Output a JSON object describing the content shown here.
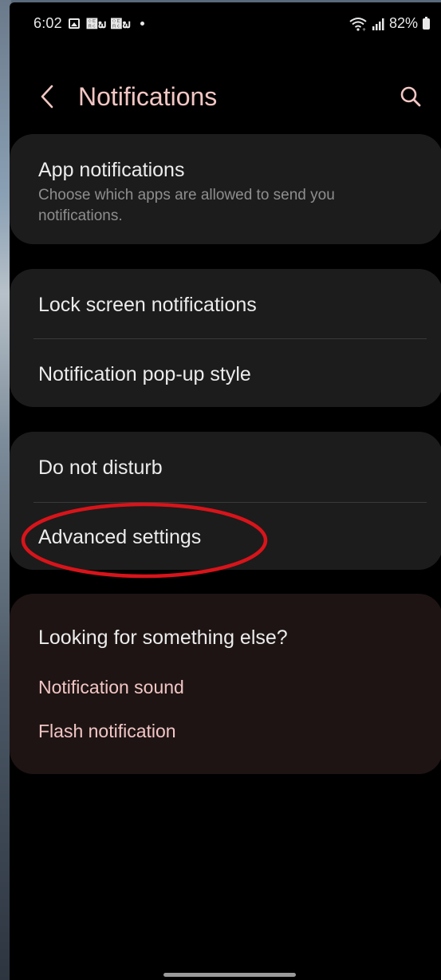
{
  "status_bar": {
    "time": "6:02",
    "app_glyphs": "຦ພ ຦ພ",
    "battery": "82%",
    "icons": [
      "gallery-icon",
      "wifi-icon",
      "signal-icon",
      "battery-icon"
    ]
  },
  "header": {
    "title": "Notifications",
    "icons": [
      "back-arrow-icon",
      "search-icon"
    ]
  },
  "sections": {
    "app_notifications": {
      "title": "App notifications",
      "subtitle": "Choose which apps are allowed to send you notifications."
    },
    "lock_screen": {
      "title": "Lock screen notifications"
    },
    "popup_style": {
      "title": "Notification pop-up style"
    },
    "do_not_disturb": {
      "title": "Do not disturb"
    },
    "advanced_settings": {
      "title": "Advanced settings"
    },
    "looking_for": {
      "title": "Looking for something else?",
      "links": [
        "Notification sound",
        "Flash notification"
      ]
    }
  },
  "colors": {
    "accent": "#f2c6c4",
    "card_bg": "#1c1c1c",
    "suggestion_bg": "#1e1414",
    "highlight_ring": "#d8141a"
  }
}
